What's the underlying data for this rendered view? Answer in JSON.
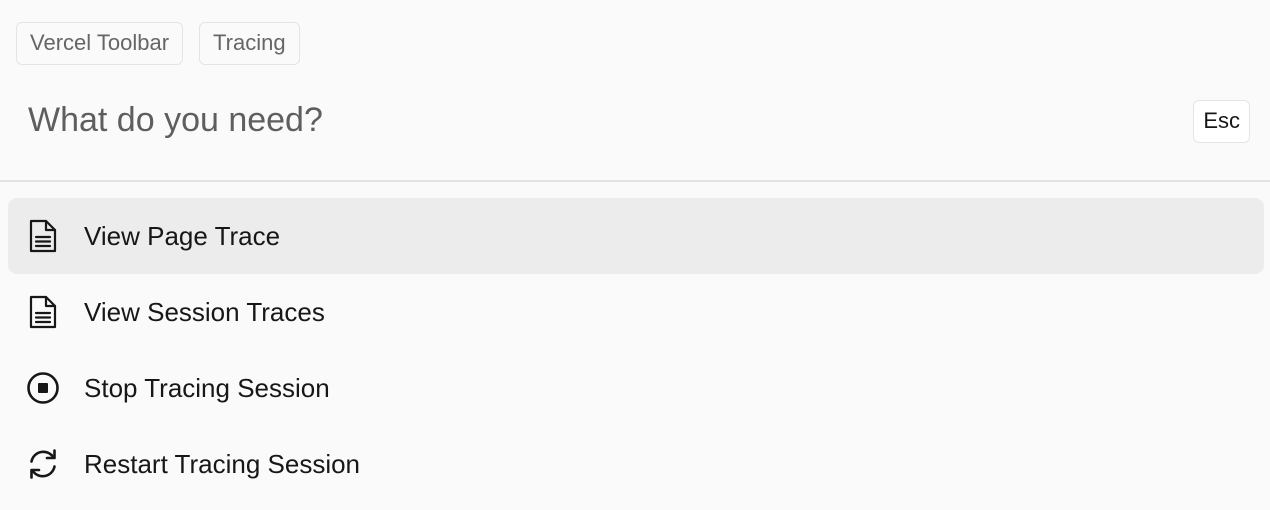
{
  "breadcrumbs": [
    "Vercel Toolbar",
    "Tracing"
  ],
  "search": {
    "placeholder": "What do you need?",
    "value": ""
  },
  "esc_label": "Esc",
  "items": [
    {
      "label": "View Page Trace",
      "icon": "document-icon",
      "selected": true
    },
    {
      "label": "View Session Traces",
      "icon": "document-icon",
      "selected": false
    },
    {
      "label": "Stop Tracing Session",
      "icon": "stop-circle-icon",
      "selected": false
    },
    {
      "label": "Restart Tracing Session",
      "icon": "refresh-icon",
      "selected": false
    }
  ],
  "colors": {
    "background": "#fafafa",
    "selected_row": "#ececec",
    "border": "#e4e4e4",
    "text": "#171717",
    "muted_text": "#666666"
  }
}
